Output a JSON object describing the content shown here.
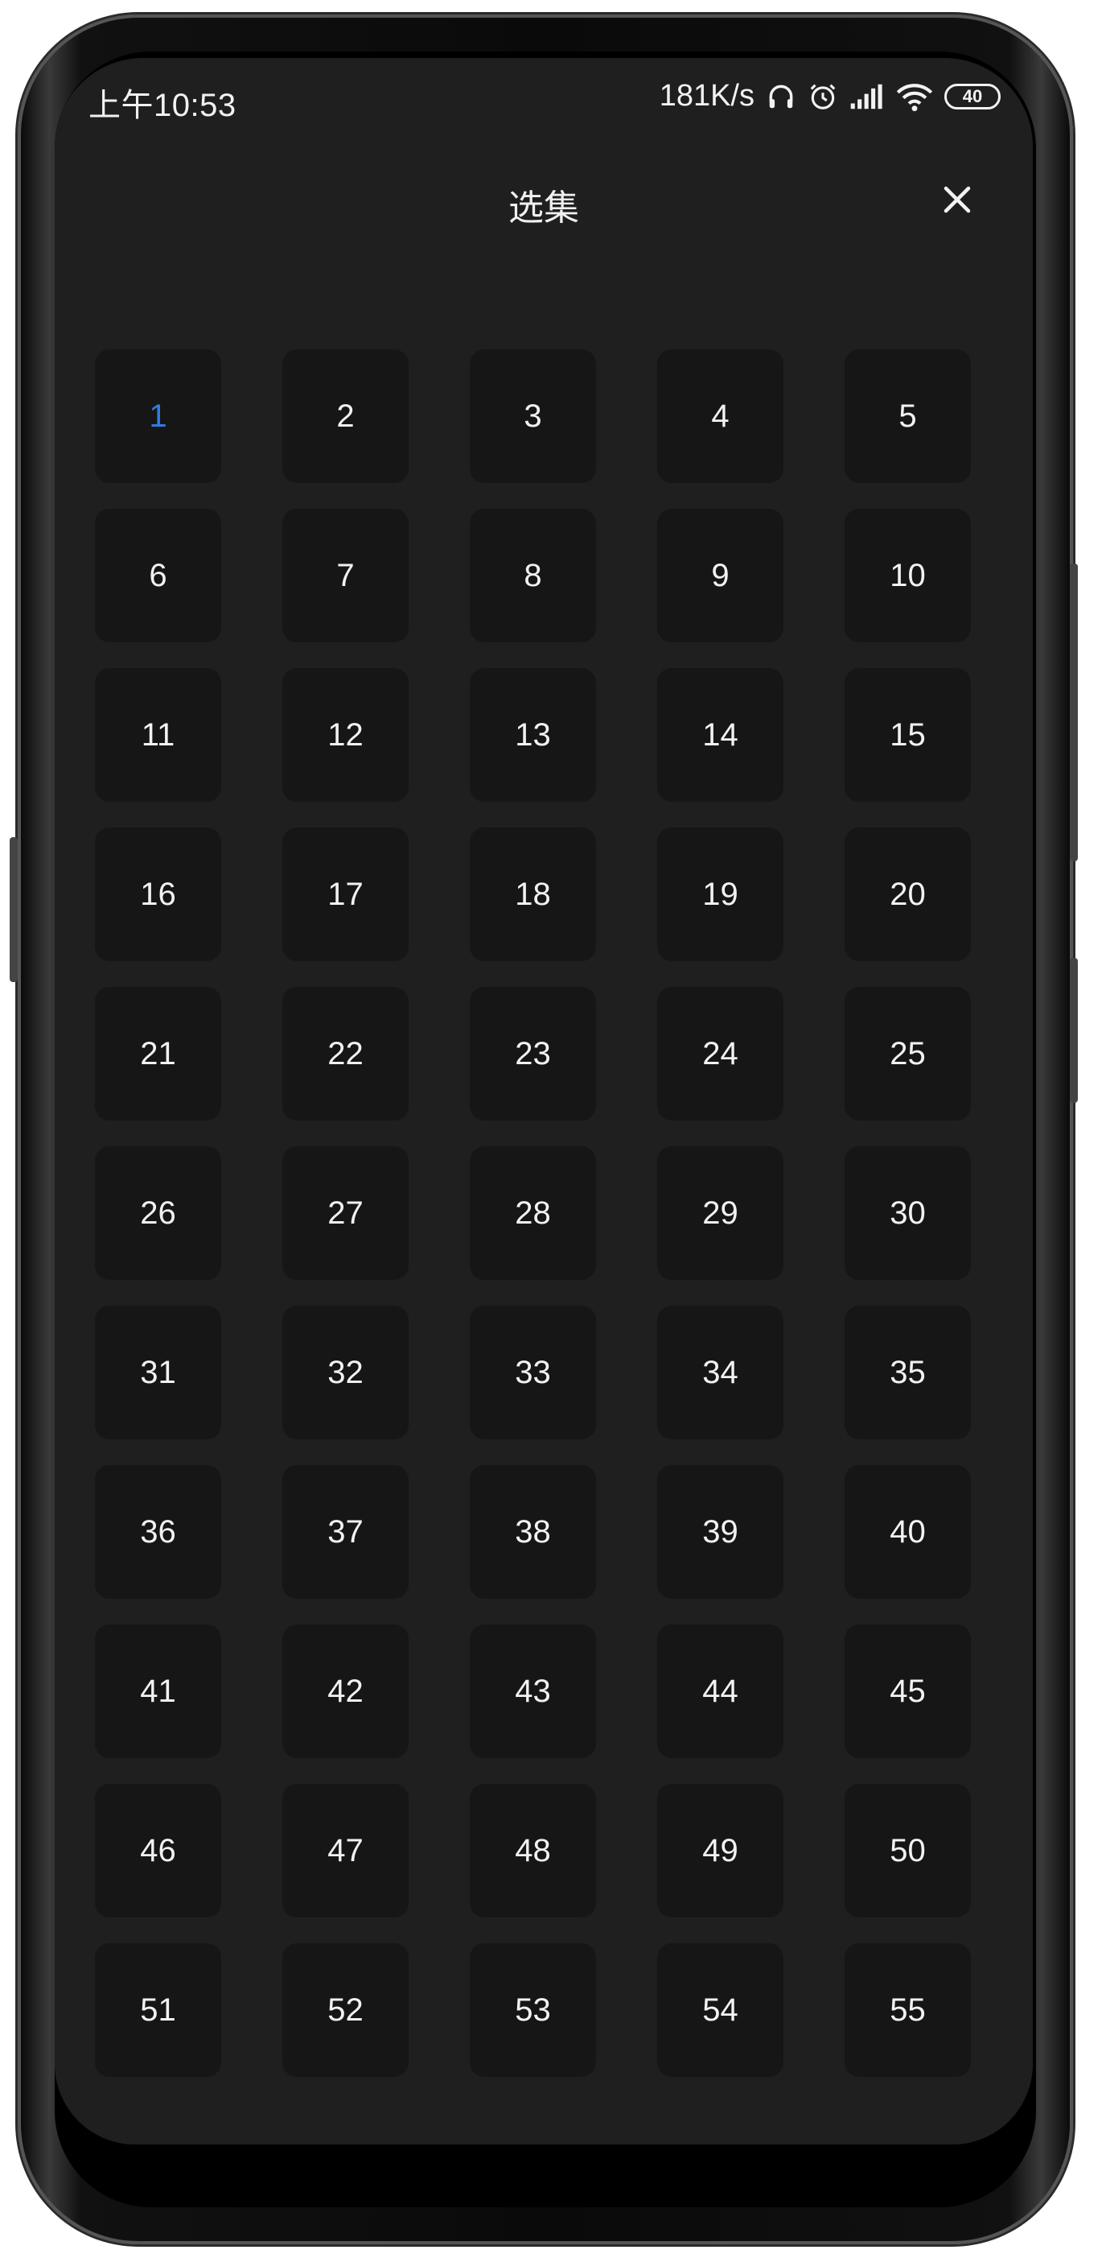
{
  "status_bar": {
    "time": "上午10:53",
    "network_speed": "181K/s",
    "battery": "40",
    "icons": [
      "headphones-icon",
      "alarm-icon",
      "signal-icon",
      "wifi-icon",
      "battery-icon"
    ]
  },
  "header": {
    "title": "选集",
    "close_icon": "close-icon"
  },
  "colors": {
    "background": "#1f1f20",
    "tile": "#161616",
    "text": "#f2f2f2",
    "selected": "#2f7de1"
  },
  "episodes": {
    "selected": "1",
    "items": [
      "1",
      "2",
      "3",
      "4",
      "5",
      "6",
      "7",
      "8",
      "9",
      "10",
      "11",
      "12",
      "13",
      "14",
      "15",
      "16",
      "17",
      "18",
      "19",
      "20",
      "21",
      "22",
      "23",
      "24",
      "25",
      "26",
      "27",
      "28",
      "29",
      "30",
      "31",
      "32",
      "33",
      "34",
      "35",
      "36",
      "37",
      "38",
      "39",
      "40",
      "41",
      "42",
      "43",
      "44",
      "45",
      "46",
      "47",
      "48",
      "49",
      "50",
      "51",
      "52",
      "53",
      "54",
      "55"
    ]
  }
}
